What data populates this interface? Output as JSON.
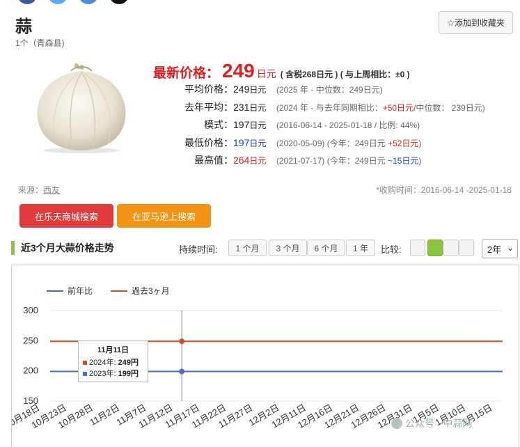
{
  "product": {
    "name": "蒜",
    "subtitle": "1个（青森县)"
  },
  "favorite_button": "☆添加到收藏夹",
  "latest_price": {
    "label": "最新价格：",
    "value": "249",
    "unit": "日元",
    "note": "( 含税268日元 ) ( 与上周相比：±0 )"
  },
  "stats": [
    {
      "label": "平均价格：",
      "value": "249",
      "unit": "日元",
      "detail": "(2025 年 - 中位数：249日元)"
    },
    {
      "label": "去年平均：",
      "value": "231",
      "unit": "日元",
      "detail_pre": "(2024 年 - 与去年同期相比：",
      "detail_red": "+50日元",
      "detail_post": "/中位数： 239日元)"
    },
    {
      "label": "模式：",
      "value": "197",
      "unit": "日元",
      "detail": "(2016-06-14 - 2025-01-18 / 比例: 44%)"
    },
    {
      "label": "最低价格：",
      "value": "197",
      "unit": "日元",
      "detail_pre": "(2020-05-09) (今年：249日元 ",
      "detail_red": "+52日元",
      "detail_post": ")"
    },
    {
      "label": "最高值：",
      "value": "264",
      "unit": "日元",
      "detail_pre": "(2021-07-17) (今年：249日元 ",
      "detail_blue": "~15日元",
      "detail_post": ")"
    }
  ],
  "source": {
    "label": "来源：",
    "link": "西友"
  },
  "collection_period": "*收购时间：2016-06-14 -2025-01-18",
  "buttons": {
    "rakuten": "在乐天商城搜索",
    "amazon": "在亚马逊上搜索"
  },
  "section_title": "近3个月大蒜价格走势",
  "duration_label": "持续时间:",
  "ranges": [
    "1 个月",
    "3 个月",
    "6 个月",
    "1 年"
  ],
  "compare_label": "比较:",
  "year_select": "2年",
  "colors": {
    "series_prev_year": "#4a6cc8",
    "series_3m": "#c8502a",
    "accent_green": "#8cc63f"
  },
  "chart_data": {
    "type": "line",
    "legend": [
      "前年比",
      "過去3ヶ月"
    ],
    "legend_placement": "top-left",
    "ylim": [
      150,
      300
    ],
    "yticks": [
      150,
      200,
      250,
      300
    ],
    "categories": [
      "10月18日",
      "10月23日",
      "10月28日",
      "11月2日",
      "11月7日",
      "11月12日",
      "11月17日",
      "11月22日",
      "11月27日",
      "12月2日",
      "12月11日",
      "12月16日",
      "12月21日",
      "12月26日",
      "12月31日",
      "1月5日",
      "1月10日",
      "1月15日"
    ],
    "series": [
      {
        "name": "過去3ヶ月",
        "color": "#c8502a",
        "values": [
          249,
          249,
          249,
          249,
          249,
          249,
          249,
          249,
          249,
          249,
          249,
          249,
          249,
          249,
          249,
          249,
          249,
          249
        ]
      },
      {
        "name": "前年比",
        "color": "#4a6cc8",
        "values": [
          199,
          199,
          199,
          199,
          199,
          199,
          199,
          199,
          199,
          199,
          199,
          199,
          199,
          199,
          199,
          199,
          199,
          199
        ]
      }
    ],
    "tooltip": {
      "date": "11月11日",
      "rows": [
        {
          "label": "2024年:",
          "value": "249円",
          "color": "#c8502a"
        },
        {
          "label": "2023年:",
          "value": "199円",
          "color": "#4a6cc8"
        }
      ]
    },
    "grid": true
  },
  "watermark": "公众号 · 中蒜网"
}
